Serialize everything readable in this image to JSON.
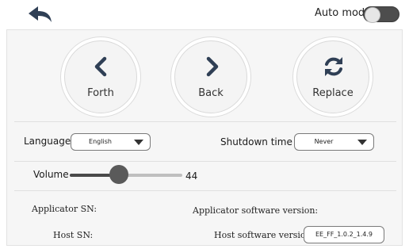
{
  "header": {
    "auto_mode_label": "Auto mode",
    "auto_mode_on": true
  },
  "actions": [
    {
      "label": "Forth",
      "icon": "chevron-left-icon"
    },
    {
      "label": "Back",
      "icon": "chevron-right-icon"
    },
    {
      "label": "Replace",
      "icon": "refresh-icon"
    }
  ],
  "settings": {
    "language_label": "Language",
    "language_value": "English",
    "shutdown_label": "Shutdown time",
    "shutdown_value": "Never",
    "volume_label": "Volume",
    "volume_value": "44",
    "volume_fraction": 0.44
  },
  "info": {
    "applicator_sn_label": "Applicator SN:",
    "applicator_sw_label": "Applicator software version:",
    "host_sn_label": "Host SN:",
    "host_sw_label": "Host software version:",
    "host_sw_value": "EE_FF_1.0.2_1.4.9"
  },
  "colors": {
    "accent": "#4d4d4d",
    "panel": "#f6f6f6"
  }
}
